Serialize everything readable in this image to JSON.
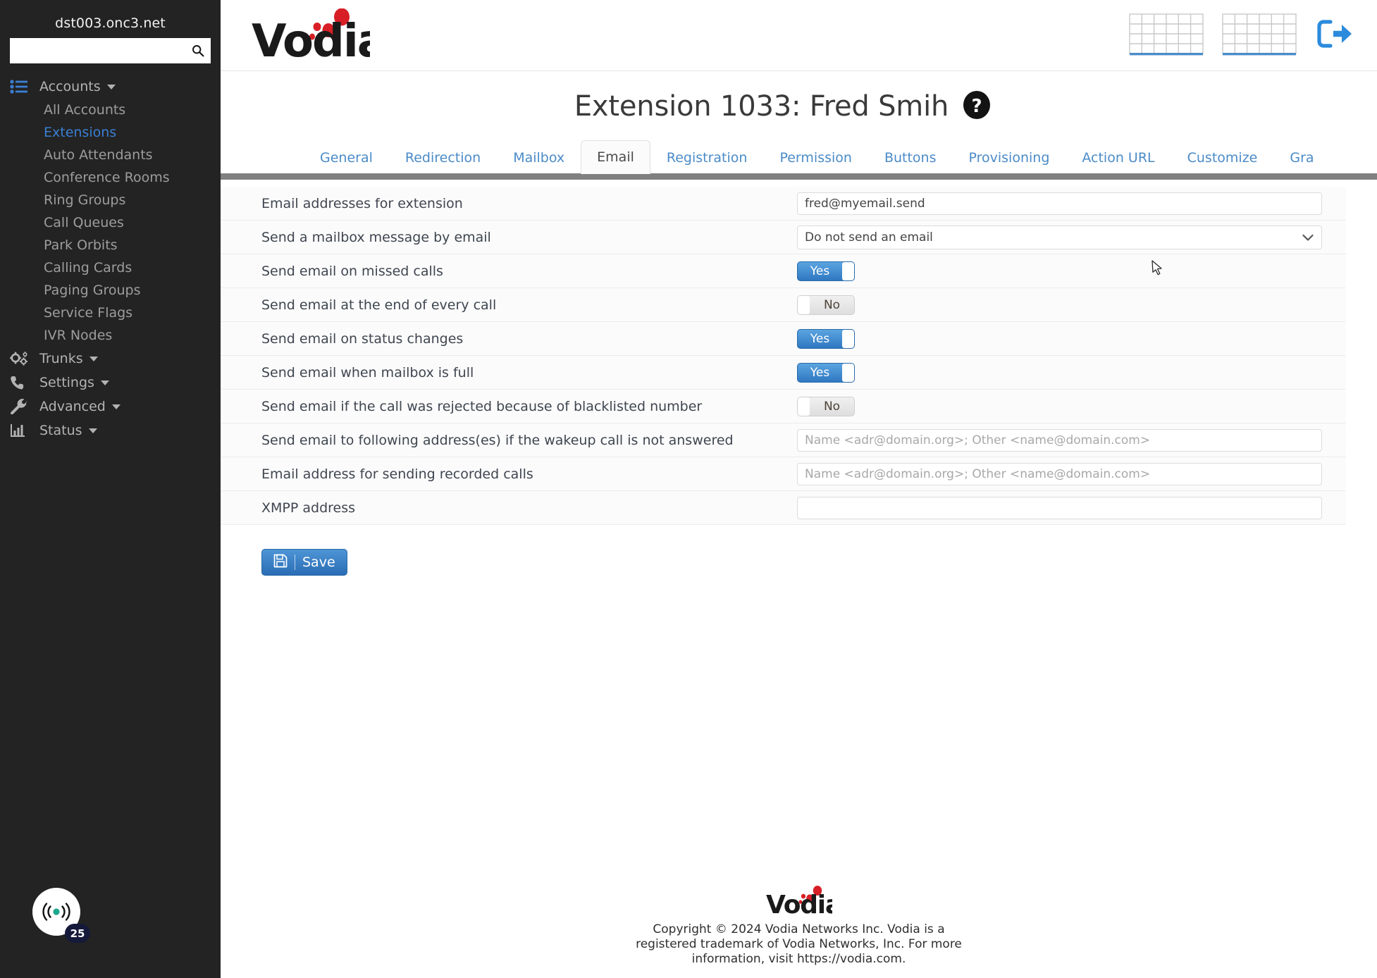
{
  "sidebar": {
    "host": "dst003.onc3.net",
    "search": {
      "value": "",
      "placeholder": ""
    },
    "groups": [
      {
        "label": "Accounts",
        "icon": "list-icon"
      },
      {
        "label": "Trunks",
        "icon": "gears-icon"
      },
      {
        "label": "Settings",
        "icon": "phone-icon"
      },
      {
        "label": "Advanced",
        "icon": "wrench-icon"
      },
      {
        "label": "Status",
        "icon": "chart-icon"
      }
    ],
    "accounts_items": [
      {
        "label": "All Accounts",
        "active": false
      },
      {
        "label": "Extensions",
        "active": true
      },
      {
        "label": "Auto Attendants",
        "active": false
      },
      {
        "label": "Conference Rooms",
        "active": false
      },
      {
        "label": "Ring Groups",
        "active": false
      },
      {
        "label": "Call Queues",
        "active": false
      },
      {
        "label": "Park Orbits",
        "active": false
      },
      {
        "label": "Calling Cards",
        "active": false
      },
      {
        "label": "Paging Groups",
        "active": false
      },
      {
        "label": "Service Flags",
        "active": false
      },
      {
        "label": "IVR Nodes",
        "active": false
      }
    ],
    "sip_badge": {
      "count": "25",
      "icon": "broadcast-icon"
    }
  },
  "header": {
    "logo_text": "Vodia",
    "icons": [
      {
        "name": "grid-table-icon-1"
      },
      {
        "name": "grid-table-icon-2"
      },
      {
        "name": "logout-icon"
      }
    ]
  },
  "page": {
    "title": "Extension 1033: Fred Smih",
    "help_icon": "help-circle-icon"
  },
  "tabs": [
    {
      "label": "General",
      "active": false
    },
    {
      "label": "Redirection",
      "active": false
    },
    {
      "label": "Mailbox",
      "active": false
    },
    {
      "label": "Email",
      "active": true
    },
    {
      "label": "Registration",
      "active": false
    },
    {
      "label": "Permission",
      "active": false
    },
    {
      "label": "Buttons",
      "active": false
    },
    {
      "label": "Provisioning",
      "active": false
    },
    {
      "label": "Action URL",
      "active": false
    },
    {
      "label": "Customize",
      "active": false
    },
    {
      "label": "Gra",
      "active": false
    }
  ],
  "form": {
    "rows": [
      {
        "label": "Email addresses for extension",
        "type": "text",
        "value": "fred@myemail.send",
        "placeholder": ""
      },
      {
        "label": "Send a mailbox message by email",
        "type": "select",
        "value": "Do not send an email",
        "options": [
          "Do not send an email"
        ]
      },
      {
        "label": "Send email on missed calls",
        "type": "toggle",
        "value": "Yes",
        "state": "on"
      },
      {
        "label": "Send email at the end of every call",
        "type": "toggle",
        "value": "No",
        "state": "off"
      },
      {
        "label": "Send email on status changes",
        "type": "toggle",
        "value": "Yes",
        "state": "on"
      },
      {
        "label": "Send email when mailbox is full",
        "type": "toggle",
        "value": "Yes",
        "state": "on"
      },
      {
        "label": "Send email if the call was rejected because of blacklisted number",
        "type": "toggle",
        "value": "No",
        "state": "off"
      },
      {
        "label": "Send email to following address(es) if the wakeup call is not answered",
        "type": "text",
        "value": "",
        "placeholder": "Name <adr@domain.org>; Other <name@domain.com>"
      },
      {
        "label": "Email address for sending recorded calls",
        "type": "text",
        "value": "",
        "placeholder": "Name <adr@domain.org>; Other <name@domain.com>"
      },
      {
        "label": "XMPP address",
        "type": "text",
        "value": "",
        "placeholder": ""
      }
    ],
    "save_label": "Save",
    "save_icon": "floppy-disk-icon"
  },
  "footer": {
    "logo_text": "Vodia",
    "text": "Copyright © 2024 Vodia Networks Inc. Vodia is a registered trademark of Vodia Networks, Inc. For more information, visit https://vodia.com."
  },
  "colors": {
    "accent_blue": "#4b8bc8",
    "toggle_on": "#2f78c1",
    "sidebar_bg": "#232323",
    "brand_red": "#d81f26",
    "badge_bg": "#15193a",
    "badge_dot": "#1aa88b"
  }
}
